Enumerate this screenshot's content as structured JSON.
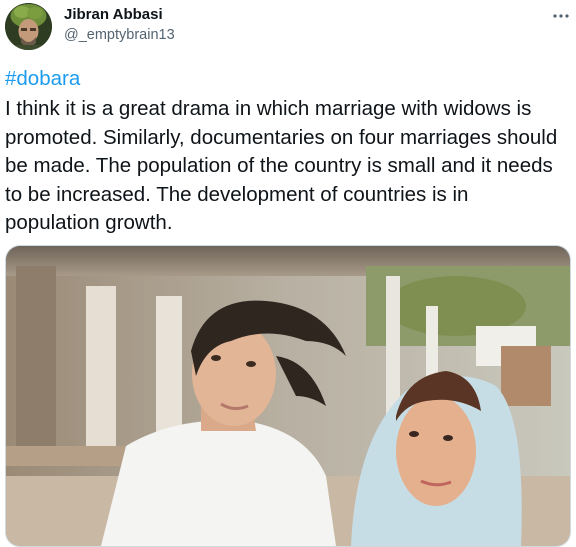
{
  "author": {
    "name": "Jibran Abbasi",
    "handle": "@_emptybrain13"
  },
  "tweet": {
    "hashtag": "#dobara",
    "text": "I think it is a great drama in which marriage with widows is promoted. Similarly, documentaries on four marriages should be made. The population of the country is small and it needs to be increased. The development of countries is in population growth."
  },
  "icons": {
    "more": "more-horizontal-icon"
  },
  "colors": {
    "link": "#1d9bf0",
    "secondary_text": "#536471",
    "primary_text": "#0f1419"
  }
}
